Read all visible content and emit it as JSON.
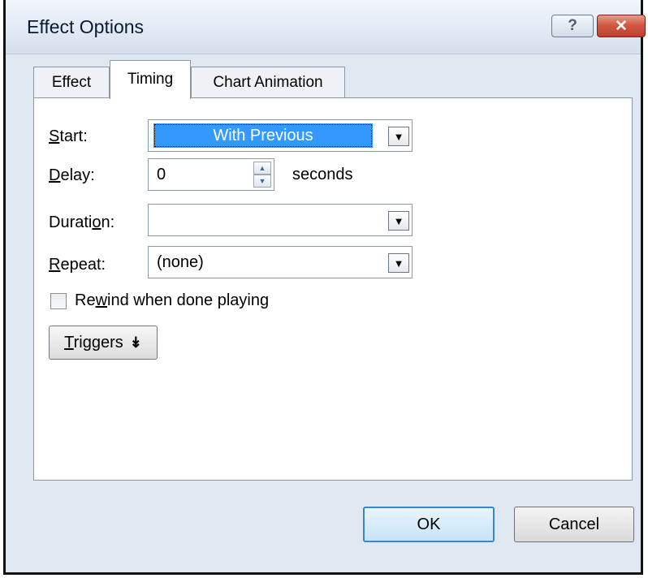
{
  "window": {
    "title": "Effect Options",
    "help_glyph": "?",
    "close_glyph": "✕"
  },
  "tabs": [
    {
      "label": "Effect",
      "selected": false
    },
    {
      "label": "Timing",
      "selected": true
    },
    {
      "label": "Chart Animation",
      "selected": false
    }
  ],
  "timing": {
    "start": {
      "label_mnemonic": "S",
      "label_rest": "tart:",
      "value": "With Previous"
    },
    "delay": {
      "label_mnemonic": "D",
      "label_rest": "elay:",
      "value": "0",
      "unit": "seconds"
    },
    "duration": {
      "label_before": "Durati",
      "label_mnemonic": "o",
      "label_rest": "n:",
      "value": ""
    },
    "repeat": {
      "label_mnemonic": "R",
      "label_rest": "epeat:",
      "value": "(none)"
    },
    "rewind": {
      "label_before": "Re",
      "label_mnemonic": "w",
      "label_rest": "ind when done playing",
      "checked": false
    },
    "triggers": {
      "label_mnemonic": "T",
      "label_rest": "riggers",
      "icon": "double-chevron-down-icon"
    }
  },
  "buttons": {
    "ok": "OK",
    "cancel": "Cancel"
  },
  "colors": {
    "selection": "#3399ff",
    "close_button": "#c9452f",
    "titlebar": "#e2eaf4"
  }
}
